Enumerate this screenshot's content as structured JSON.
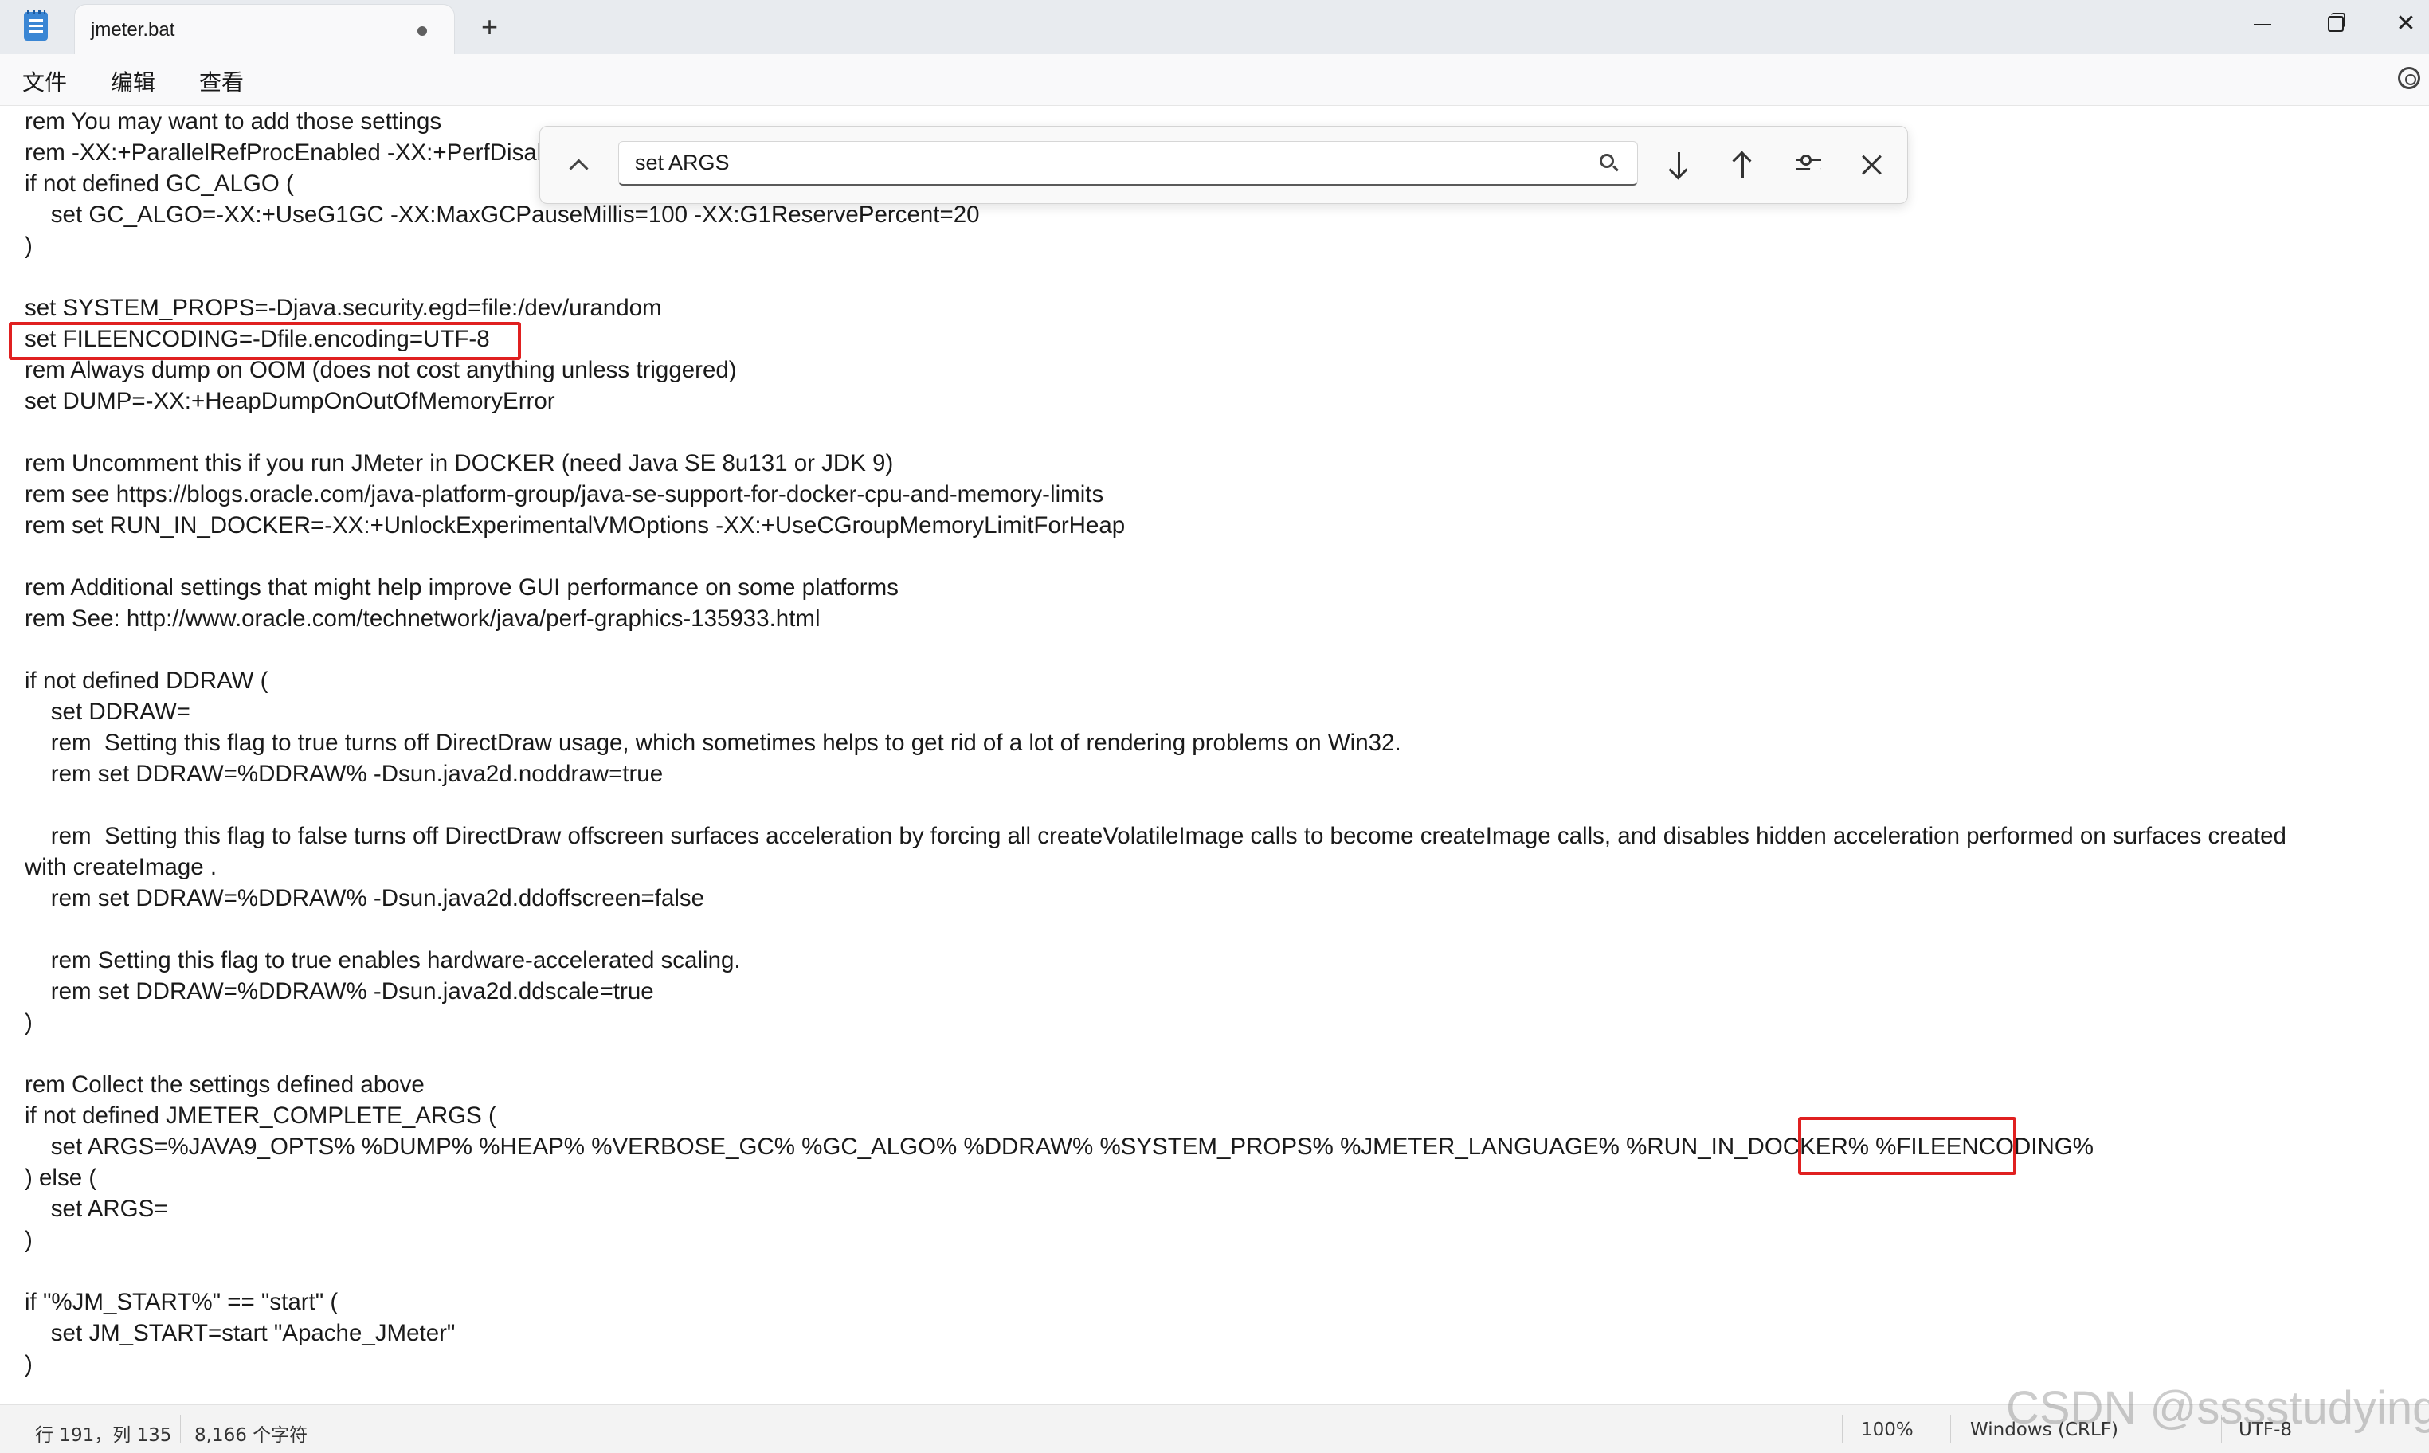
{
  "titlebar": {
    "app_icon": "notepad-icon",
    "tab_title": "jmeter.bat",
    "unsaved_indicator": "dot-icon",
    "new_tab": "+",
    "window_controls": [
      "minimize-icon",
      "maximize-icon",
      "close-icon"
    ]
  },
  "menu": {
    "file": "文件",
    "edit": "编辑",
    "view": "查看",
    "settings_icon": "gear-icon"
  },
  "find": {
    "query": "set ARGS",
    "toggle_icon": "chevron-up-icon",
    "search_icon": "search-icon",
    "next_icon": "arrow-down-icon",
    "prev_icon": "arrow-up-icon",
    "options_icon": "sliders-icon",
    "close_icon": "close-icon"
  },
  "editor": {
    "lines": [
      "rem You may want to add those settings",
      "rem -XX:+ParallelRefProcEnabled -XX:+PerfDisableSharedMem",
      "if not defined GC_ALGO (",
      "    set GC_ALGO=-XX:+UseG1GC -XX:MaxGCPauseMillis=100 -XX:G1ReservePercent=20",
      ")",
      "",
      "set SYSTEM_PROPS=-Djava.security.egd=file:/dev/urandom",
      "set FILEENCODING=-Dfile.encoding=UTF-8",
      "rem Always dump on OOM (does not cost anything unless triggered)",
      "set DUMP=-XX:+HeapDumpOnOutOfMemoryError",
      "",
      "rem Uncomment this if you run JMeter in DOCKER (need Java SE 8u131 or JDK 9)",
      "rem see https://blogs.oracle.com/java-platform-group/java-se-support-for-docker-cpu-and-memory-limits",
      "rem set RUN_IN_DOCKER=-XX:+UnlockExperimentalVMOptions -XX:+UseCGroupMemoryLimitForHeap",
      "",
      "rem Additional settings that might help improve GUI performance on some platforms",
      "rem See: http://www.oracle.com/technetwork/java/perf-graphics-135933.html",
      "",
      "if not defined DDRAW (",
      "    set DDRAW=",
      "    rem  Setting this flag to true turns off DirectDraw usage, which sometimes helps to get rid of a lot of rendering problems on Win32.",
      "    rem set DDRAW=%DDRAW% -Dsun.java2d.noddraw=true",
      "",
      "    rem  Setting this flag to false turns off DirectDraw offscreen surfaces acceleration by forcing all createVolatileImage calls to become createImage calls, and disables hidden acceleration performed on surfaces created",
      "with createImage .",
      "    rem set DDRAW=%DDRAW% -Dsun.java2d.ddoffscreen=false",
      "",
      "    rem Setting this flag to true enables hardware-accelerated scaling.",
      "    rem set DDRAW=%DDRAW% -Dsun.java2d.ddscale=true",
      ")",
      "",
      "rem Collect the settings defined above",
      "if not defined JMETER_COMPLETE_ARGS (",
      "    set ARGS=%JAVA9_OPTS% %DUMP% %HEAP% %VERBOSE_GC% %GC_ALGO% %DDRAW% %SYSTEM_PROPS% %JMETER_LANGUAGE% %RUN_IN_DOCKER% %FILEENCODING%",
      ") else (",
      "    set ARGS=",
      ")",
      "",
      "if \"%JM_START%\" == \"start\" (",
      "    set JM_START=start \"Apache_JMeter\"",
      ")"
    ]
  },
  "status": {
    "position": "行 191，列 135",
    "char_count": "8,166 个字符",
    "zoom": "100%",
    "line_ending": "Windows (CRLF)",
    "encoding": "UTF-8"
  },
  "watermark": "CSDN @sssstudying",
  "colors": {
    "highlight_box": "#e02020",
    "titlebar_bg": "#e8ebef"
  }
}
